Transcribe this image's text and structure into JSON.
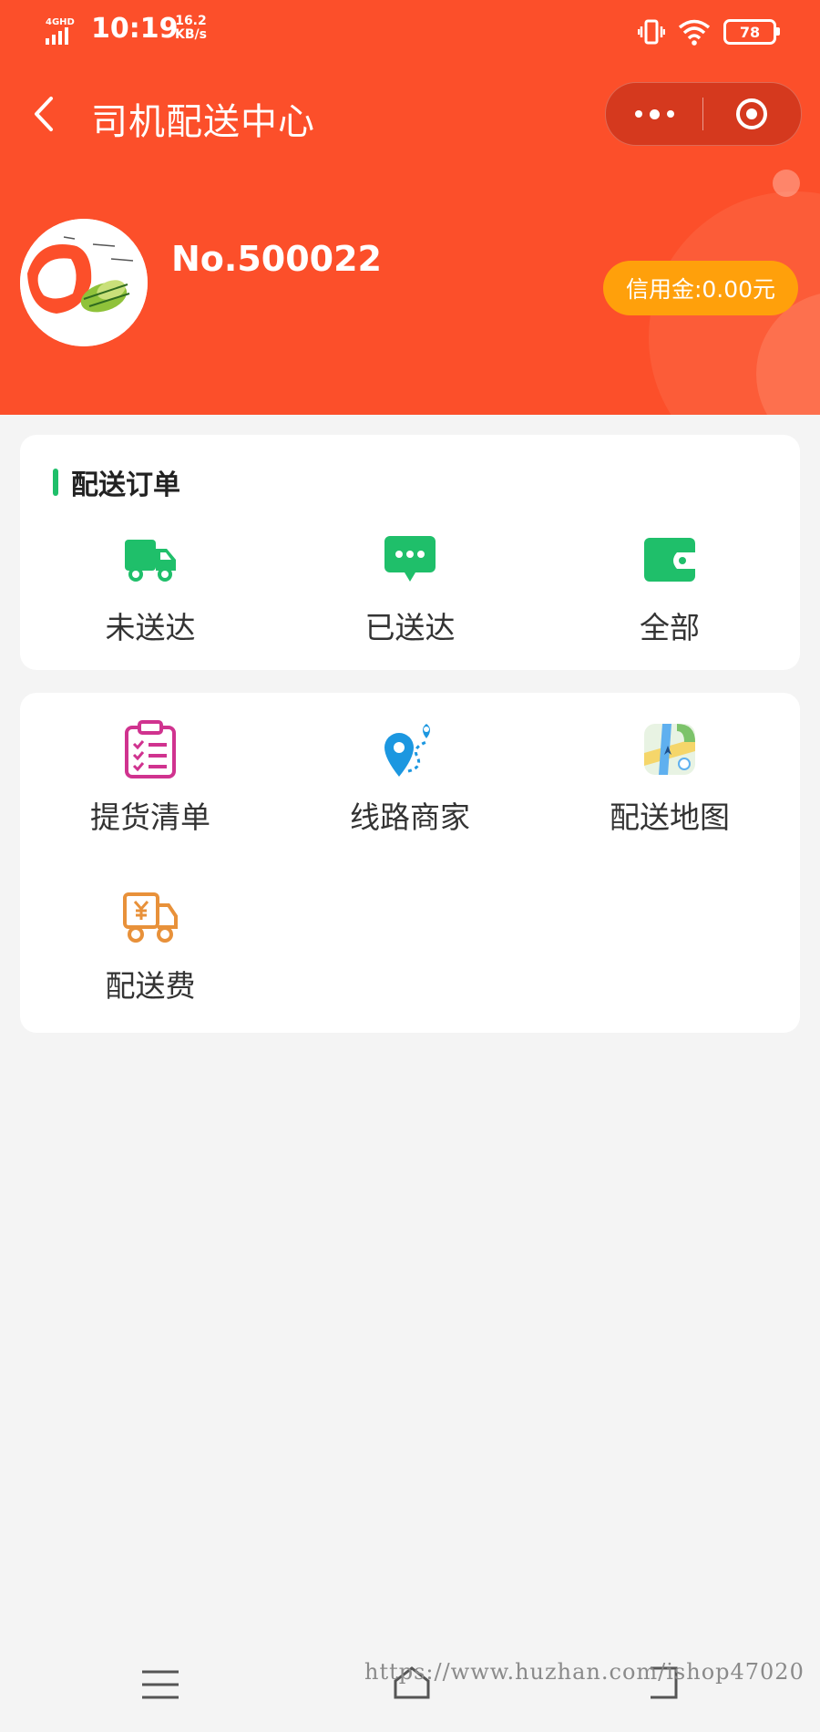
{
  "status_bar": {
    "network": "4GHD",
    "time": "10:19",
    "speed_value": "16.2",
    "speed_unit": "KB/s",
    "battery": "78"
  },
  "nav": {
    "title": "司机配送中心"
  },
  "profile": {
    "driver_no": "No.500022",
    "credit": "信用金:0.00元"
  },
  "delivery_orders": {
    "title": "配送订单",
    "items": [
      {
        "label": "未送达",
        "icon": "truck-icon"
      },
      {
        "label": "已送达",
        "icon": "chat-bubble-icon"
      },
      {
        "label": "全部",
        "icon": "wallet-icon"
      }
    ]
  },
  "tools": {
    "items": [
      {
        "label": "提货清单",
        "icon": "clipboard-list-icon"
      },
      {
        "label": "线路商家",
        "icon": "route-pin-icon"
      },
      {
        "label": "配送地图",
        "icon": "map-icon"
      },
      {
        "label": "配送费",
        "icon": "yuan-truck-icon"
      }
    ]
  },
  "watermark": "https://www.huzhan.com/ishop47020",
  "colors": {
    "brand": "#fc4f2a",
    "credit_badge": "#ffa00b",
    "accent_green": "#1fbf6a",
    "clipboard": "#d0338f",
    "route": "#1c97e0",
    "fee": "#e8913a",
    "background": "#f4f4f4"
  }
}
